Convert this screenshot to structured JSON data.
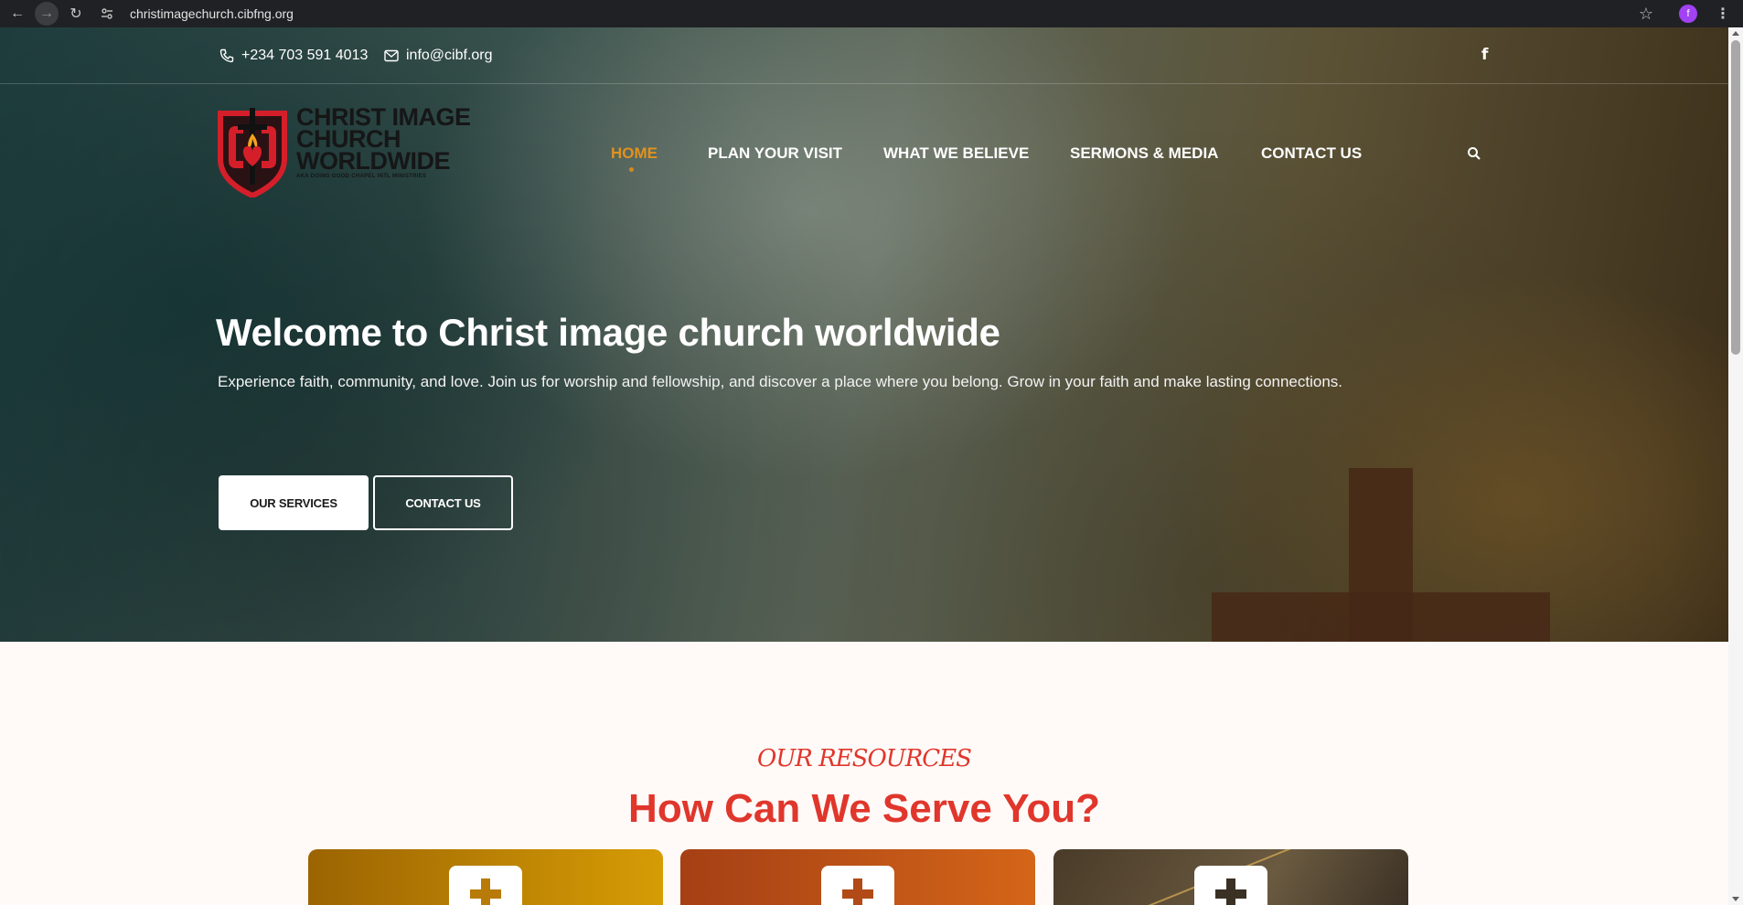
{
  "browser": {
    "url": "christimagechurch.cibfng.org",
    "profile_initial": "f"
  },
  "topbar": {
    "phone": "+234 703 591 4013",
    "email": "info@cibf.org",
    "social_icon": "facebook-icon"
  },
  "logo": {
    "line1": "CHRIST IMAGE",
    "line2": "CHURCH",
    "line3": "WORLDWIDE",
    "tagline": "AKA DOING GOOD CHAPEL INTL MINISTRIES"
  },
  "nav": {
    "items": [
      {
        "label": "HOME",
        "active": true
      },
      {
        "label": "PLAN YOUR VISIT"
      },
      {
        "label": "WHAT WE BELIEVE"
      },
      {
        "label": "SERMONS & MEDIA"
      },
      {
        "label": "CONTACT US"
      }
    ]
  },
  "hero": {
    "title": "Welcome to Christ image church worldwide",
    "subtitle": "Experience faith, community, and love. Join us for worship and fellowship, and discover a place where you belong. Grow in your faith and make lasting connections.",
    "primary_button": "OUR SERVICES",
    "secondary_button": "CONTACT US"
  },
  "resources": {
    "eyebrow": "OUR RESOURCES",
    "title": "How Can We Serve You?"
  },
  "colors": {
    "accent": "#e0921e",
    "heading_red": "#e0362c",
    "page_bg": "#fffaf7"
  }
}
